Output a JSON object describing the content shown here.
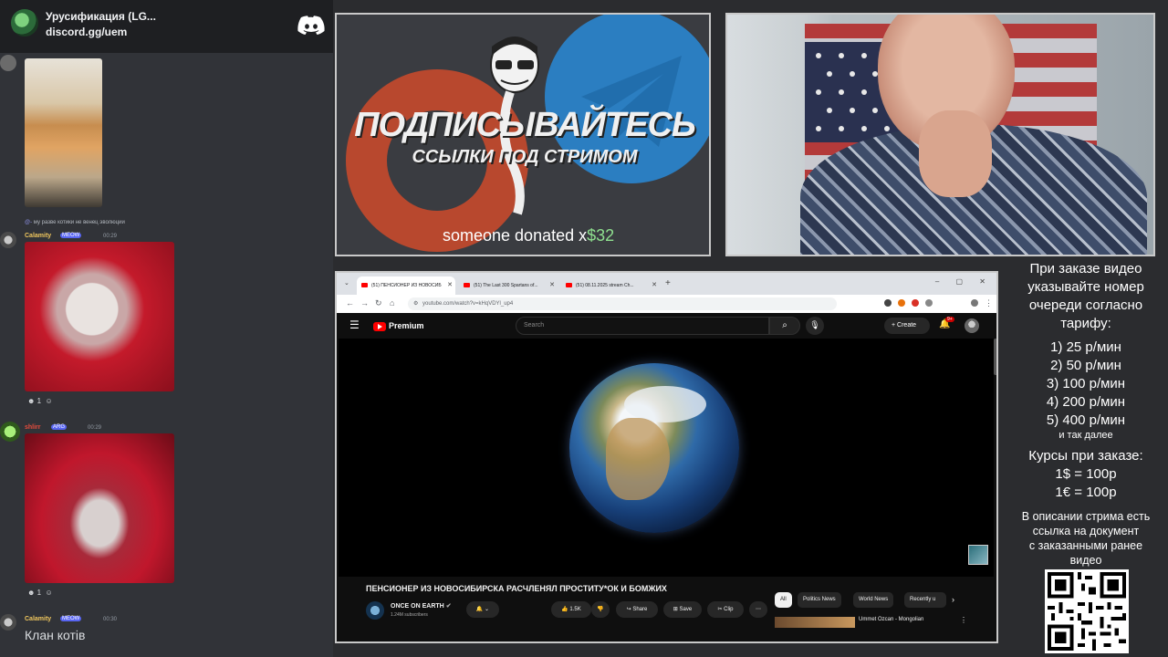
{
  "chat": {
    "server_name": "Урусификация (LG...",
    "server_invite": "discord.gg/uem",
    "reply_text": "му разве котики не венец эволюции",
    "messages": [
      {
        "user": "Calamity",
        "badge": "MEOW",
        "time": "00:29",
        "reaction_count": "1"
      },
      {
        "user": "shlirr",
        "badge": "ARG",
        "time": "00:29",
        "reaction_count": "1"
      },
      {
        "user": "Calamity",
        "badge": "MEOW",
        "time": "00:30",
        "text": "Клан котів"
      }
    ],
    "colors": {
      "calamity": "#f0c75e",
      "shlirr": "#e74c3c"
    }
  },
  "banner": {
    "title": "ПОДПИСЫВАЙТЕСЬ",
    "subtitle": "ССЫЛКИ ПОД СТРИМОМ",
    "donation_prefix": "someone donated x",
    "donation_amount": "$32"
  },
  "browser": {
    "tabs": [
      {
        "label": "(51) ПЕНСИОНЕР ИЗ НОВОСИБ"
      },
      {
        "label": "(51) The Last 300 Spartans of..."
      },
      {
        "label": "(51) 08.11.2025 stream Ch..."
      }
    ],
    "url": "youtube.com/watch?v=kHqVDYl_up4"
  },
  "youtube": {
    "brand": "Premium",
    "search_placeholder": "Search",
    "create_label": "Create",
    "notif_count": "9+",
    "video_title": "ПЕНСИОНЕР ИЗ НОВОСИБИРСКА РАСЧЛЕНЯЛ ПРОСТИТУ*ОК И БОМЖИХ",
    "channel_name": "ONCE ON EARTH",
    "channel_subs": "1.24M subscribers",
    "likes": "1.5K",
    "share_label": "Share",
    "save_label": "Save",
    "clip_label": "Clip",
    "chips": [
      "All",
      "Politics News",
      "World News",
      "Recently u"
    ],
    "rec_title": "Ummet Ozcan - Mongolian"
  },
  "info": {
    "heading": [
      "При заказе видео",
      "указывайте номер",
      "очереди согласно",
      "тарифу:"
    ],
    "tariffs": [
      "1) 25 р/мин",
      "2) 50 р/мин",
      "3) 100 р/мин",
      "4) 200 р/мин",
      "5) 400 р/мин"
    ],
    "tariffs_more": "и так далее",
    "rates_title": "Курсы при заказе:",
    "rates": [
      "1$ = 100р",
      "1€ = 100р"
    ],
    "note": [
      "В описании стрима есть",
      "ссылка на документ",
      "с заказанными ранее",
      "видео"
    ]
  }
}
